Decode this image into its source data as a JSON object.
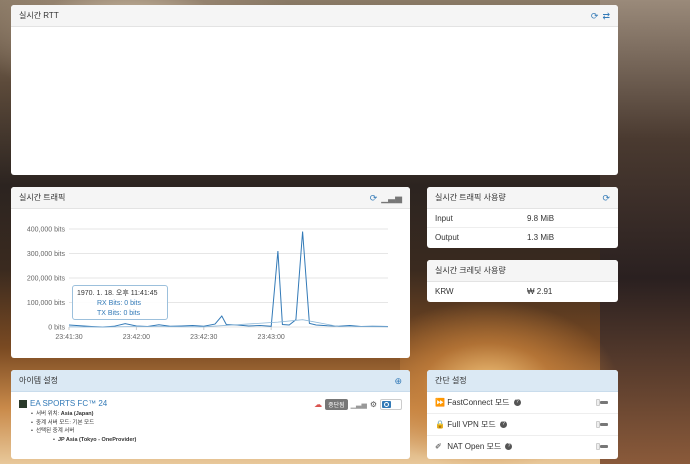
{
  "rtt": {
    "title": "실시간 RTT"
  },
  "traffic": {
    "title": "실시간 트래픽",
    "tooltip": {
      "time": "1970. 1. 18. 오후 11:41:45",
      "rx": "RX Bits: 0 bits",
      "tx": "TX Bits: 0 bits"
    }
  },
  "usage": {
    "title": "실시간 트래픽 사용량",
    "rows": [
      {
        "label": "Input",
        "value": "9.8 MiB"
      },
      {
        "label": "Output",
        "value": "1.3 MiB"
      }
    ]
  },
  "credit": {
    "title": "실시간 크레딧 사용량",
    "rows": [
      {
        "label": "KRW",
        "value": "₩ 2.91"
      }
    ]
  },
  "items": {
    "title": "아이템 설정",
    "game": {
      "name": "EA SPORTS FC™ 24",
      "status": "중단됨",
      "server_location_label": "서버 위치: ",
      "server_location": "Asia (Japan)",
      "relay_mode": "중계 서버 모드: 기본 모드",
      "selected_relay": "선택된 중계 서버",
      "relay_server": "JP Asia (Tokyo - OneProvider)"
    }
  },
  "quick": {
    "title": "간단 설정",
    "options": [
      {
        "label": "FastConnect 모드"
      },
      {
        "label": "Full VPN 모드"
      },
      {
        "label": "NAT Open 모드"
      }
    ]
  },
  "chart_data": {
    "type": "line",
    "title": "",
    "xlabel": "",
    "ylabel": "",
    "y_ticks": [
      "0 bits",
      "100,000 bits",
      "200,000 bits",
      "300,000 bits",
      "400,000 bits"
    ],
    "x_ticks": [
      "23:41:30",
      "23:42:00",
      "23:42:30",
      "23:43:00"
    ],
    "ylim": [
      0,
      400000
    ],
    "xlim": [
      "23:41:30",
      "23:43:52"
    ],
    "grid": true,
    "colors": {
      "rx": "#337ab7",
      "tx": "#8fb8d8"
    },
    "series": [
      {
        "x": [
          "23:41:30",
          "23:41:40",
          "23:41:45",
          "23:41:50",
          "23:41:55",
          "23:42:00",
          "23:42:05",
          "23:42:10",
          "23:42:15",
          "23:42:20",
          "23:42:25",
          "23:42:30",
          "23:42:35",
          "23:42:38",
          "23:42:40",
          "23:42:45",
          "23:42:50",
          "23:42:55",
          "23:43:00",
          "23:43:03",
          "23:43:05",
          "23:43:08",
          "23:43:11",
          "23:43:14",
          "23:43:17",
          "23:43:20",
          "23:43:25",
          "23:43:30",
          "23:43:35",
          "23:43:40",
          "23:43:45",
          "23:43:52"
        ],
        "values": [
          8000,
          2000,
          0,
          3000,
          14000,
          4000,
          2000,
          9000,
          3000,
          4000,
          6000,
          3000,
          12000,
          45000,
          10000,
          8000,
          4000,
          6000,
          3000,
          310000,
          10000,
          8000,
          30000,
          390000,
          15000,
          8000,
          5000,
          3000,
          6000,
          2000,
          3000,
          2000
        ]
      },
      {
        "x": [
          "23:41:30",
          "23:41:45",
          "23:42:00",
          "23:42:30",
          "23:43:03",
          "23:43:14",
          "23:43:30",
          "23:43:52"
        ],
        "values": [
          1000,
          0,
          2000,
          1000,
          20000,
          30000,
          2000,
          1000
        ]
      }
    ]
  }
}
